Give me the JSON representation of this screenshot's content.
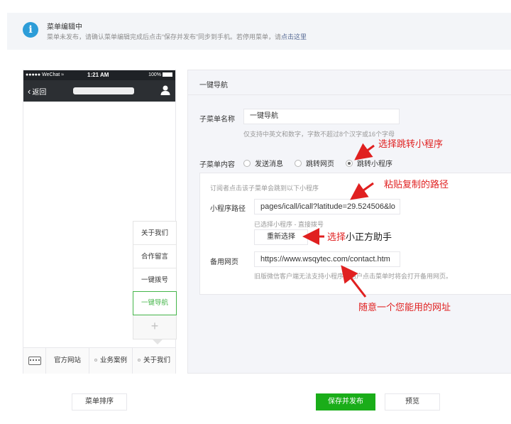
{
  "notice": {
    "title": "菜单编辑中",
    "desc_prefix": "菜单未发布，请确认菜单编辑完成后点击“保存并发布”同步到手机。若停用菜单，请",
    "desc_link": "点击这里"
  },
  "phone": {
    "status": {
      "carrier": "●●●●● WeChat ≈",
      "time": "1:21 AM",
      "battery": "100%"
    },
    "back_label": "返回",
    "submenu_items": [
      {
        "label": "关于我们",
        "active": false
      },
      {
        "label": "合作留言",
        "active": false
      },
      {
        "label": "一键拨号",
        "active": false
      },
      {
        "label": "一键导航",
        "active": true
      }
    ],
    "add_label": "+",
    "menu_items": [
      "官方网站",
      "业务案例",
      "关于我们"
    ]
  },
  "panel": {
    "title": "一键导航",
    "name_label": "子菜单名称",
    "name_value": "一键导航",
    "name_hint": "仅支持中英文和数字，字数不超过8个汉字或16个字母",
    "content_label": "子菜单内容",
    "options": [
      {
        "label": "发送消息",
        "checked": false
      },
      {
        "label": "跳转网页",
        "checked": false
      },
      {
        "label": "跳转小程序",
        "checked": true
      }
    ],
    "box_hint": "订阅者点击该子菜单会跳到以下小程序",
    "path_label": "小程序路径",
    "path_value": "pages/icall/icall?latitude=29.524506&lo",
    "selected_hint": "已选择小程序 - 直接拨号",
    "reselect_label": "重新选择",
    "backup_label": "备用网页",
    "backup_value": "https://www.wsqytec.com/contact.htm",
    "backup_hint": "旧版微信客户端无法支持小程序，用户点击菜单时将会打开备用网页。"
  },
  "annotations": {
    "select_mini": "选择跳转小程序",
    "paste_path": "粘贴复制的路径",
    "choose_prefix": "选择",
    "choose_name": "小正方助手",
    "any_url": "随意一个您能用的网址"
  },
  "footer": {
    "sort_label": "菜单排序",
    "publish_label": "保存并发布",
    "preview_label": "预览"
  },
  "colors": {
    "accent_green": "#1aad19",
    "info_blue": "#2d9dd8",
    "annotation_red": "#e02020"
  }
}
